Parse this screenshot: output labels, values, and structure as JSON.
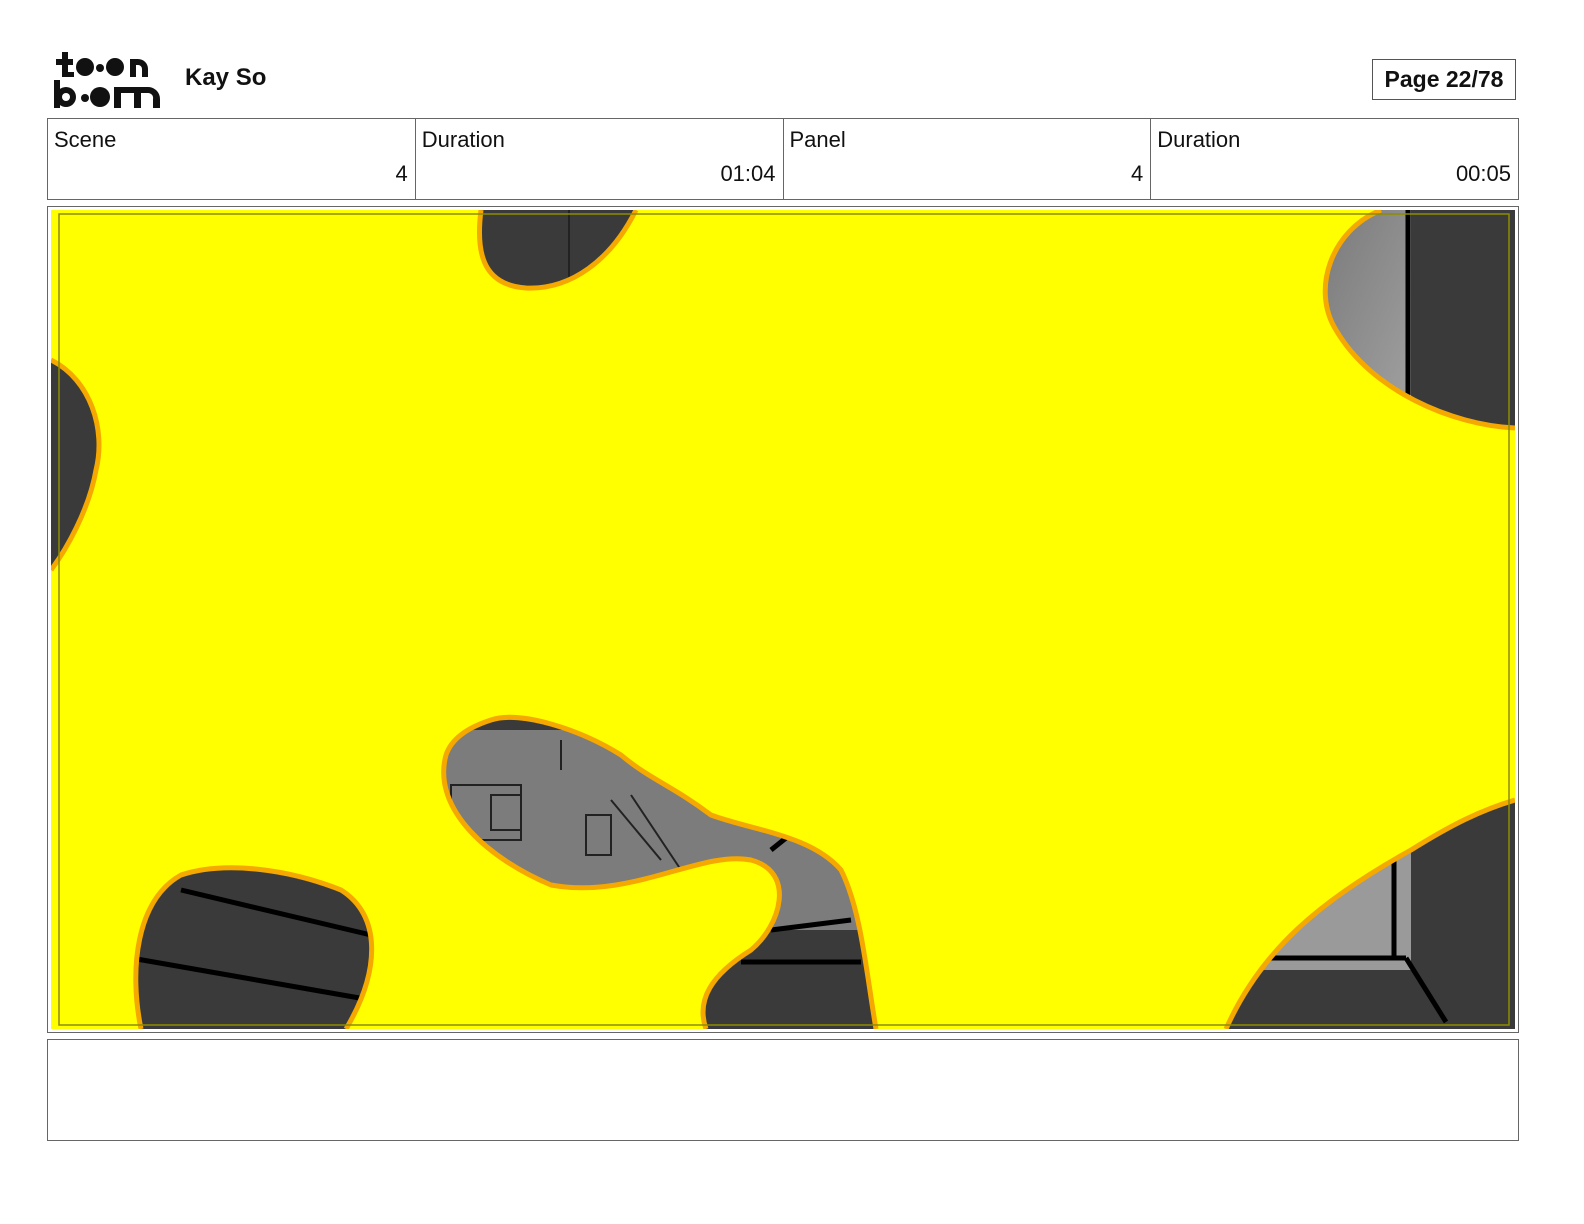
{
  "header": {
    "logo_text": "toon boom",
    "title": "Kay So",
    "page_label": "Page 22/78"
  },
  "info": {
    "scene_label": "Scene",
    "scene_value": "4",
    "scene_duration_label": "Duration",
    "scene_duration_value": "01:04",
    "panel_label": "Panel",
    "panel_value": "4",
    "panel_duration_label": "Duration",
    "panel_duration_value": "00:05"
  },
  "panel": {
    "fill_color": "#ffff00",
    "outline_color": "#f5a800",
    "background_dark": "#333333",
    "background_mid": "#8a8a8a"
  },
  "notes": {
    "text": ""
  }
}
